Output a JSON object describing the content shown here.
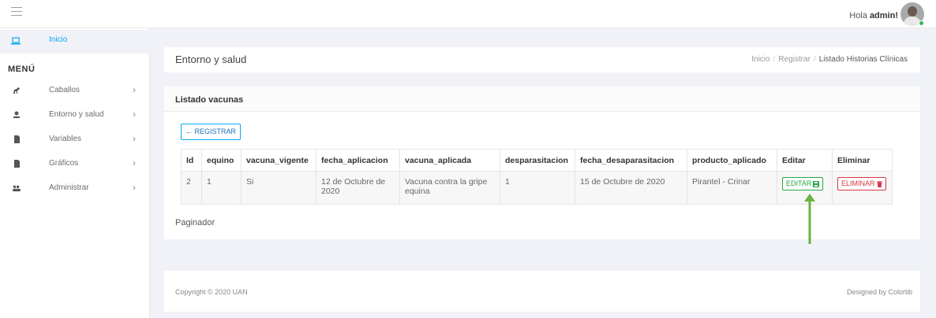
{
  "topbar": {
    "greeting_prefix": "Hola ",
    "username": "admin!"
  },
  "sidebar": {
    "home_label": "Inicio",
    "menu_title": "MENÚ",
    "items": [
      {
        "label": "Caballos",
        "icon": "horse-icon"
      },
      {
        "label": "Entorno y salud",
        "icon": "tree-icon"
      },
      {
        "label": "Variables",
        "icon": "file-icon"
      },
      {
        "label": "Gráficos",
        "icon": "file-icon"
      },
      {
        "label": "Administrar",
        "icon": "users-icon"
      }
    ]
  },
  "header": {
    "title": "Entorno y salud",
    "breadcrumb": [
      "Inicio",
      "Registrar",
      "Listado Historias Clínicas"
    ]
  },
  "card": {
    "title": "Listado vacunas",
    "register_label": "← REGISTRAR",
    "paginator": "Paginador"
  },
  "table": {
    "columns": [
      "Id",
      "equino",
      "vacuna_vigente",
      "fecha_aplicacion",
      "vacuna_aplicada",
      "desparasitacion",
      "fecha_desaparasitacion",
      "producto_aplicado",
      "Editar",
      "Eliminar"
    ],
    "rows": [
      {
        "id": "2",
        "equino": "1",
        "vacuna_vigente": "Si",
        "fecha_aplicacion": "12 de Octubre de 2020",
        "vacuna_aplicada": "Vacuna contra la gripe equina",
        "desparasitacion": "1",
        "fecha_desaparasitacion": "15 de Octubre de 2020",
        "producto_aplicado": "Pirantel - Crinar",
        "edit_label": "EDITAR",
        "delete_label": "ELIMINAR"
      }
    ]
  },
  "footer": {
    "copyright": "Copyright © 2020 UAN",
    "designed_by": "Designed by Colorlib"
  },
  "colors": {
    "accent": "#03a9f3",
    "edit": "#28a745",
    "delete": "#dc3545",
    "annotation_arrow": "#6cb33f"
  }
}
